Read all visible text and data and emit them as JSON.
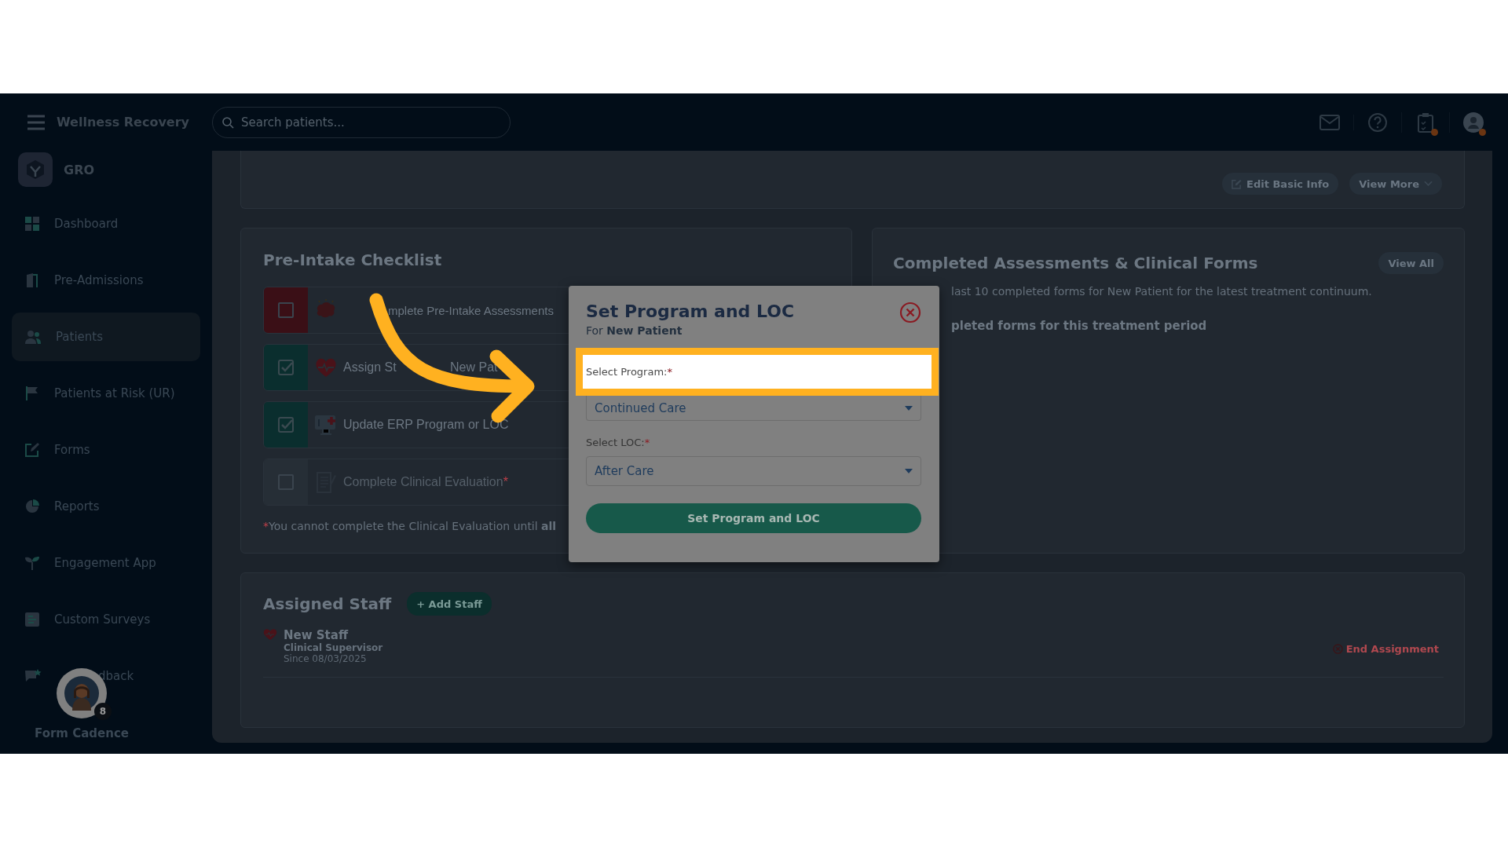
{
  "app": {
    "name": "Wellness Recovery"
  },
  "search": {
    "placeholder": "Search patients..."
  },
  "notifications": {
    "clipboard_alert": true,
    "profile_alert": true
  },
  "org": {
    "name": "GRO"
  },
  "sidebar": {
    "items": [
      {
        "label": "Dashboard",
        "kind": "grid",
        "selected": false
      },
      {
        "label": "Pre-Admissions",
        "kind": "door",
        "selected": false
      },
      {
        "label": "Patients",
        "kind": "people",
        "selected": true
      },
      {
        "label": "Patients at Risk (UR)",
        "kind": "flag",
        "selected": false
      },
      {
        "label": "Forms",
        "kind": "edit",
        "selected": false
      },
      {
        "label": "Reports",
        "kind": "pie",
        "selected": false
      },
      {
        "label": "Engagement App",
        "kind": "sprout",
        "selected": false
      },
      {
        "label": "Custom Surveys",
        "kind": "survey",
        "selected": false
      },
      {
        "label": "dback",
        "kind": "chat",
        "selected": false
      }
    ]
  },
  "floating_widget": {
    "label": "Form Cadence",
    "badge": "8"
  },
  "patient_card": {
    "buttons": [
      {
        "label": "Edit Basic Info",
        "kind": "edit"
      },
      {
        "label": "View More",
        "kind": "dropdown"
      }
    ]
  },
  "checklist": {
    "title": "Pre-Intake Checklist",
    "items": [
      {
        "label": "mplete Pre-Intake Assessments",
        "kind": "brain",
        "checked": false,
        "disabled": false
      },
      {
        "label": "Assign St",
        "label_after": "New Pat",
        "kind": "heart",
        "checked": true,
        "disabled": false
      },
      {
        "label": "Update ERP Program or LOC",
        "kind": "monitor",
        "checked": true,
        "disabled": false
      },
      {
        "label": "Complete Clinical Evaluation",
        "marker": "*",
        "kind": "document",
        "checked": false,
        "disabled": true
      }
    ],
    "footnote": {
      "marker": "*",
      "text": "You cannot complete the Clinical Evaluation until **all**"
    }
  },
  "forms_panel": {
    "title": "Completed Assessments & Clinical Forms",
    "button": "View All",
    "description": "last 10 completed forms for New Patient for the latest treatment continuum.",
    "empty_message": "pleted forms for this treatment period"
  },
  "staff": {
    "title": "Assigned Staff",
    "add_button": "+ Add Staff",
    "members": [
      {
        "name": "New Staff",
        "role": "Clinical Supervisor",
        "since": "Since 08/03/2025",
        "action": "End Assignment"
      }
    ]
  },
  "dialog": {
    "title": "Set Program and LOC",
    "subtitle": "For **New Patient**",
    "fields": [
      {
        "label": "Select Program:",
        "marker": "*",
        "value": "Continued Care",
        "highlighted": true
      },
      {
        "label": "Select LOC:",
        "marker": "*",
        "value": "After Care",
        "highlighted": false
      }
    ],
    "submit": "Set Program and LOC"
  }
}
